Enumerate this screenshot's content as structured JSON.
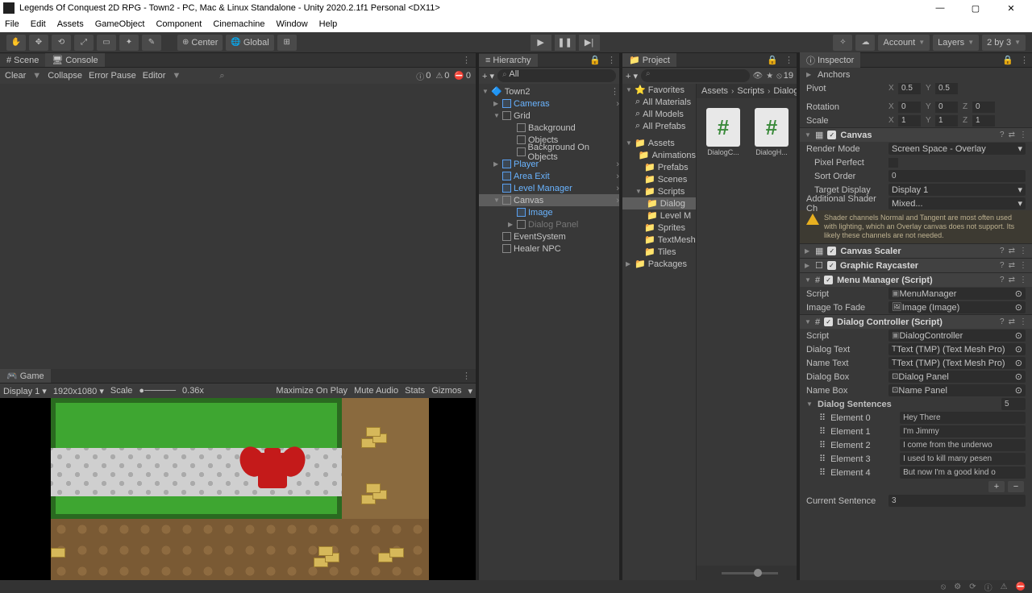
{
  "titlebar": {
    "title": "Legends Of Conquest 2D RPG - Town2 - PC, Mac & Linux Standalone - Unity 2020.2.1f1 Personal <DX11>"
  },
  "menubar": [
    "File",
    "Edit",
    "Assets",
    "GameObject",
    "Component",
    "Cinemachine",
    "Window",
    "Help"
  ],
  "toolbar": {
    "center": "Center",
    "global": "Global",
    "account": "Account",
    "layers": "Layers",
    "layout": "2 by 3"
  },
  "scene_tab": "Scene",
  "console_tab": "Console",
  "console": {
    "clear": "Clear",
    "collapse": "Collapse",
    "errorpause": "Error Pause",
    "editor": "Editor",
    "search_icon": "⌕",
    "count0": "0"
  },
  "game_tab": "Game",
  "game": {
    "display": "Display 1",
    "res": "1920x1080",
    "scale_label": "Scale",
    "scale_val": "0.36x",
    "max": "Maximize On Play",
    "mute": "Mute Audio",
    "stats": "Stats",
    "gizmos": "Gizmos"
  },
  "hierarchy_tab": "Hierarchy",
  "hierarchy": {
    "search": "All",
    "root": "Town2",
    "items": [
      "Cameras",
      "Grid",
      "Background",
      "Objects",
      "Background On Objects",
      "Player",
      "Area Exit",
      "Level Manager",
      "Canvas",
      "Image",
      "Dialog Panel",
      "EventSystem",
      "Healer NPC"
    ]
  },
  "project_tab": "Project",
  "project": {
    "favorites": "Favorites",
    "fav_items": [
      "All Materials",
      "All Models",
      "All Prefabs"
    ],
    "assets": "Assets",
    "asset_folders": [
      "Animations",
      "Prefabs",
      "Scenes",
      "Scripts",
      "Dialog",
      "Level M",
      "Sprites",
      "TextMesh",
      "Tiles"
    ],
    "packages": "Packages",
    "breadcrumb": [
      "Assets",
      "Scripts",
      "Dialog"
    ],
    "files": [
      "DialogC...",
      "DialogH..."
    ],
    "badge": "19"
  },
  "inspector_tab": "Inspector",
  "inspector": {
    "anchors": "Anchors",
    "pivot": "Pivot",
    "pivot_x": "0.5",
    "pivot_y": "0.5",
    "rotation": "Rotation",
    "rot_x": "0",
    "rot_y": "0",
    "rot_z": "0",
    "scale": "Scale",
    "scl_x": "1",
    "scl_y": "1",
    "scl_z": "1",
    "canvas": "Canvas",
    "rendermode_l": "Render Mode",
    "rendermode_v": "Screen Space - Overlay",
    "pixelperfect": "Pixel Perfect",
    "sortorder_l": "Sort Order",
    "sortorder_v": "0",
    "targetdisplay_l": "Target Display",
    "targetdisplay_v": "Display 1",
    "addshader_l": "Additional Shader Ch",
    "addshader_v": "Mixed...",
    "warning": "Shader channels Normal and Tangent are most often used with lighting, which an Overlay canvas does not support. Its likely these channels are not needed.",
    "canvasscaler": "Canvas Scaler",
    "raycaster": "Graphic Raycaster",
    "menumanager": "Menu Manager (Script)",
    "mm_script_l": "Script",
    "mm_script_v": "MenuManager",
    "mm_img_l": "Image To Fade",
    "mm_img_v": "Image (Image)",
    "dialogctrl": "Dialog Controller (Script)",
    "dc_script_l": "Script",
    "dc_script_v": "DialogController",
    "dc_dialogtext_l": "Dialog Text",
    "dc_dialogtext_v": "Text (TMP) (Text Mesh Pro)",
    "dc_nametext_l": "Name Text",
    "dc_nametext_v": "Text (TMP) (Text Mesh Pro)",
    "dc_dialogbox_l": "Dialog Box",
    "dc_dialogbox_v": "Dialog Panel",
    "dc_namebox_l": "Name Box",
    "dc_namebox_v": "Name Panel",
    "sentences_l": "Dialog Sentences",
    "sentences_n": "5",
    "elements": [
      {
        "l": "Element 0",
        "v": "Hey There"
      },
      {
        "l": "Element 1",
        "v": "I'm Jimmy"
      },
      {
        "l": "Element 2",
        "v": "I come from the underwo"
      },
      {
        "l": "Element 3",
        "v": "I used to kill many pesen"
      },
      {
        "l": "Element 4",
        "v": "But now I'm a good kind o"
      }
    ],
    "currsent_l": "Current Sentence",
    "currsent_v": "3"
  }
}
